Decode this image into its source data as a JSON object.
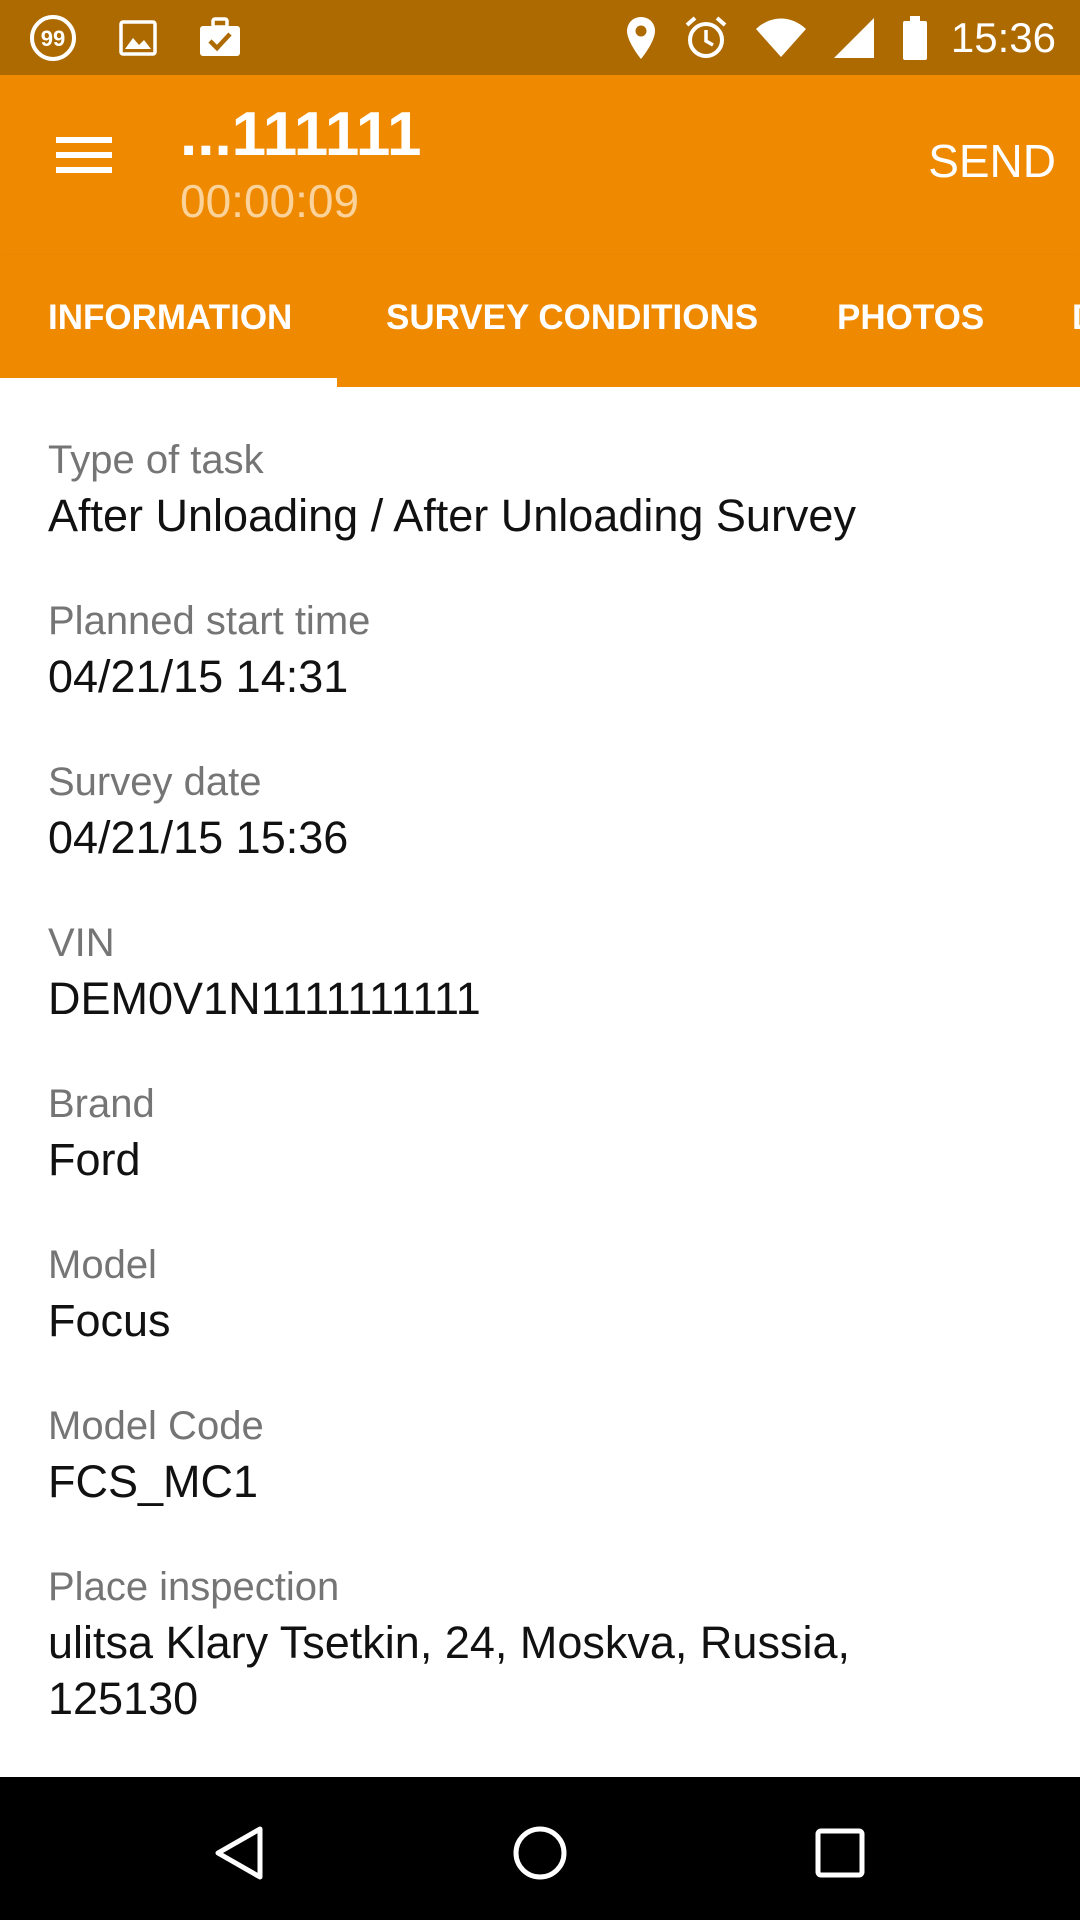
{
  "status_bar": {
    "time": "15:36",
    "left_icons": [
      "badge-99-icon",
      "image-icon",
      "briefcase-check-icon"
    ],
    "right_icons": [
      "location-icon",
      "alarm-icon",
      "wifi-icon",
      "signal-icon",
      "battery-icon"
    ],
    "badge_text": "99"
  },
  "app_bar": {
    "title": "...111111",
    "subtitle": "00:00:09",
    "send_label": "SEND"
  },
  "tabs": [
    {
      "label": "INFORMATION",
      "selected": true
    },
    {
      "label": "SURVEY CONDITIONS",
      "selected": false
    },
    {
      "label": "PHOTOS",
      "selected": false
    },
    {
      "label": "D",
      "selected": false
    }
  ],
  "fields": [
    {
      "label": "Type of task",
      "value": "After Unloading / After Unloading Survey"
    },
    {
      "label": "Planned start time",
      "value": "04/21/15 14:31"
    },
    {
      "label": "Survey date",
      "value": "04/21/15 15:36"
    },
    {
      "label": "VIN",
      "value": "DEM0V1N1111111111"
    },
    {
      "label": "Brand",
      "value": "Ford"
    },
    {
      "label": "Model",
      "value": "Focus"
    },
    {
      "label": "Model Code",
      "value": "FCS_MC1"
    },
    {
      "label": "Place inspection",
      "value_lines": [
        "ulitsa Klary Tsetkin, 24, Moskva, Russia,",
        "125130"
      ]
    }
  ],
  "colors": {
    "status_bar": "#ad6a00",
    "primary": "#ef8a00",
    "subtitle": "#fbd39a",
    "label": "#757575",
    "value": "#111111",
    "nav_bar": "#000000"
  },
  "nav_bar": {
    "icons": [
      "back-icon",
      "home-icon",
      "recent-apps-icon"
    ]
  }
}
